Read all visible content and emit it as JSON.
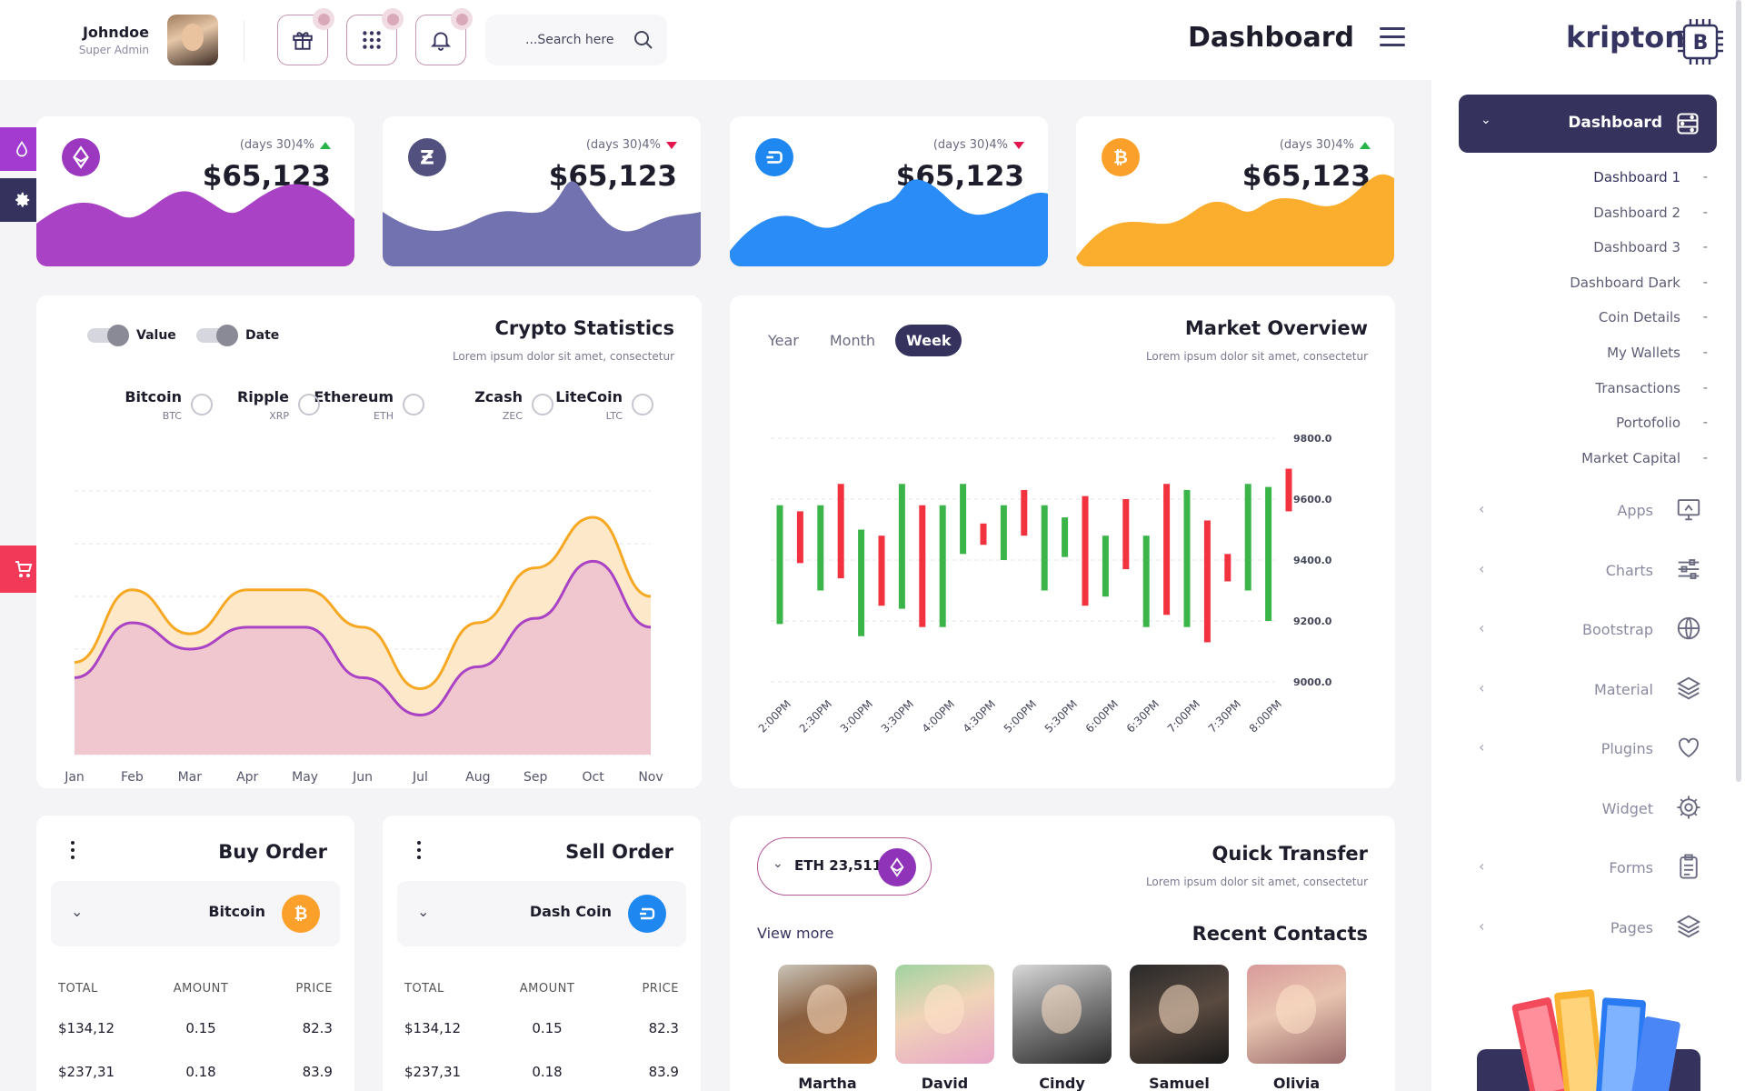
{
  "header": {
    "user_name": "Johndoe",
    "user_role": "Super Admin",
    "search_placeholder": "...Search here",
    "page_title": "Dashboard"
  },
  "brand": {
    "name": "kripton",
    "icon": "chip-bitcoin-icon"
  },
  "sidebar": {
    "active": "Dashboard",
    "subitems": [
      {
        "label": "Dashboard 1",
        "mark": "-"
      },
      {
        "label": "Dashboard 2",
        "mark": "-"
      },
      {
        "label": "Dashboard 3",
        "mark": "-"
      },
      {
        "label": "Dashboard Dark",
        "mark": "-"
      },
      {
        "label": "Coin Details",
        "mark": "-"
      },
      {
        "label": "My Wallets",
        "mark": "-"
      },
      {
        "label": "Transactions",
        "mark": "-"
      },
      {
        "label": "Portofolio",
        "mark": "-"
      },
      {
        "label": "Market Capital",
        "mark": "-"
      }
    ],
    "items": [
      {
        "label": "Apps",
        "icon": "monitor-icon",
        "has_chevron": true
      },
      {
        "label": "Charts",
        "icon": "sliders-icon",
        "has_chevron": true
      },
      {
        "label": "Bootstrap",
        "icon": "globe-icon",
        "has_chevron": true
      },
      {
        "label": "Material",
        "icon": "layers-icon",
        "has_chevron": true
      },
      {
        "label": "Plugins",
        "icon": "heart-icon",
        "has_chevron": true
      },
      {
        "label": "Widget",
        "icon": "gear-icon",
        "has_chevron": false
      },
      {
        "label": "Forms",
        "icon": "clipboard-icon",
        "has_chevron": true
      },
      {
        "label": "Pages",
        "icon": "layers-icon",
        "has_chevron": true
      }
    ]
  },
  "stats": [
    {
      "coin": "ethereum",
      "change": "(days 30)4%",
      "direction": "up",
      "amount": "$65,123",
      "color": "#a942c4",
      "icon_bg": "#9c37bf"
    },
    {
      "coin": "zcash",
      "change": "(days 30)4%",
      "direction": "down",
      "amount": "$65,123",
      "color": "#7272b0",
      "icon_bg": "#51507e"
    },
    {
      "coin": "dash",
      "change": "(days 30)4%",
      "direction": "down",
      "amount": "$65,123",
      "color": "#2a8cf7",
      "icon_bg": "#1e88f0"
    },
    {
      "coin": "bitcoin",
      "change": "(days 30)4%",
      "direction": "up",
      "amount": "$65,123",
      "color": "#fbad2d",
      "icon_bg": "#fba02a"
    }
  ],
  "crypto_stats": {
    "title": "Crypto Statistics",
    "subtitle": "Lorem ipsum dolor sit amet, consectetur",
    "toggles": [
      "Value",
      "Date"
    ],
    "coins": [
      {
        "name": "LiteCoin",
        "ticker": "LTC"
      },
      {
        "name": "Zcash",
        "ticker": "ZEC"
      },
      {
        "name": "Ethereum",
        "ticker": "ETH"
      },
      {
        "name": "Ripple",
        "ticker": "XRP"
      },
      {
        "name": "Bitcoin",
        "ticker": "BTC"
      }
    ]
  },
  "market": {
    "title": "Market Overview",
    "subtitle": "Lorem ipsum dolor sit amet, consectetur",
    "tabs": [
      "Year",
      "Month",
      "Week"
    ],
    "active_tab": "Week"
  },
  "buy_order": {
    "title": "Buy Order",
    "coin": "Bitcoin",
    "headers": [
      "TOTAL",
      "AMOUNT",
      "PRICE"
    ],
    "rows": [
      [
        "$134,12",
        "0.15",
        "82.3"
      ],
      [
        "$237,31",
        "0.18",
        "83.9"
      ]
    ]
  },
  "sell_order": {
    "title": "Sell Order",
    "coin": "Dash Coin",
    "headers": [
      "TOTAL",
      "AMOUNT",
      "PRICE"
    ],
    "rows": [
      [
        "$134,12",
        "0.15",
        "82.3"
      ],
      [
        "$237,31",
        "0.18",
        "83.9"
      ]
    ]
  },
  "quick_transfer": {
    "title": "Quick Transfer",
    "subtitle": "Lorem ipsum dolor sit amet, consectetur",
    "wallet": "ETH 23,511",
    "view_more": "View more",
    "recent_title": "Recent Contacts",
    "contacts": [
      "Martha",
      "David",
      "Cindy",
      "Samuel",
      "Olivia"
    ]
  },
  "chart_data": [
    {
      "type": "area",
      "title": "Crypto Statistics",
      "categories": [
        "Jan",
        "Feb",
        "Mar",
        "Apr",
        "May",
        "Jun",
        "Jul",
        "Aug",
        "Sep",
        "Oct",
        "Nov"
      ],
      "series": [
        {
          "values": [
            42,
            75,
            55,
            75,
            75,
            58,
            30,
            60,
            85,
            108,
            72
          ],
          "color": "#f7a823"
        },
        {
          "values": [
            35,
            60,
            48,
            58,
            58,
            35,
            18,
            40,
            62,
            88,
            58
          ],
          "color": "#a942c4"
        }
      ],
      "ylim": [
        0,
        120
      ],
      "grid": true
    },
    {
      "type": "candlestick",
      "title": "Market Overview",
      "x": [
        "2:00PM",
        "2:30PM",
        "3:00PM",
        "3:30PM",
        "4:00PM",
        "4:30PM",
        "5:00PM",
        "5:30PM",
        "6:00PM",
        "6:30PM",
        "7:00PM",
        "7:30PM",
        "8:00PM"
      ],
      "y_ticks": [
        "9800.0",
        "9600.0",
        "9400.0",
        "9200.0",
        "9000.0"
      ],
      "ylim": [
        9000,
        9800
      ],
      "candles": [
        {
          "low": 9190,
          "high": 9580,
          "up": true
        },
        {
          "low": 9390,
          "high": 9560,
          "up": false
        },
        {
          "low": 9300,
          "high": 9580,
          "up": true
        },
        {
          "low": 9340,
          "high": 9650,
          "up": false
        },
        {
          "low": 9150,
          "high": 9500,
          "up": true
        },
        {
          "low": 9250,
          "high": 9480,
          "up": false
        },
        {
          "low": 9240,
          "high": 9650,
          "up": true
        },
        {
          "low": 9180,
          "high": 9580,
          "up": false
        },
        {
          "low": 9180,
          "high": 9580,
          "up": true
        },
        {
          "low": 9420,
          "high": 9650,
          "up": true
        },
        {
          "low": 9450,
          "high": 9520,
          "up": false
        },
        {
          "low": 9400,
          "high": 9580,
          "up": true
        },
        {
          "low": 9480,
          "high": 9630,
          "up": false
        },
        {
          "low": 9300,
          "high": 9580,
          "up": true
        },
        {
          "low": 9410,
          "high": 9540,
          "up": true
        },
        {
          "low": 9250,
          "high": 9610,
          "up": false
        },
        {
          "low": 9280,
          "high": 9480,
          "up": true
        },
        {
          "low": 9370,
          "high": 9600,
          "up": false
        },
        {
          "low": 9180,
          "high": 9480,
          "up": true
        },
        {
          "low": 9220,
          "high": 9650,
          "up": false
        },
        {
          "low": 9180,
          "high": 9630,
          "up": true
        },
        {
          "low": 9130,
          "high": 9530,
          "up": false
        },
        {
          "low": 9330,
          "high": 9420,
          "up": false
        },
        {
          "low": 9300,
          "high": 9650,
          "up": true
        },
        {
          "low": 9200,
          "high": 9640,
          "up": true
        },
        {
          "low": 9560,
          "high": 9700,
          "up": false
        }
      ]
    }
  ]
}
